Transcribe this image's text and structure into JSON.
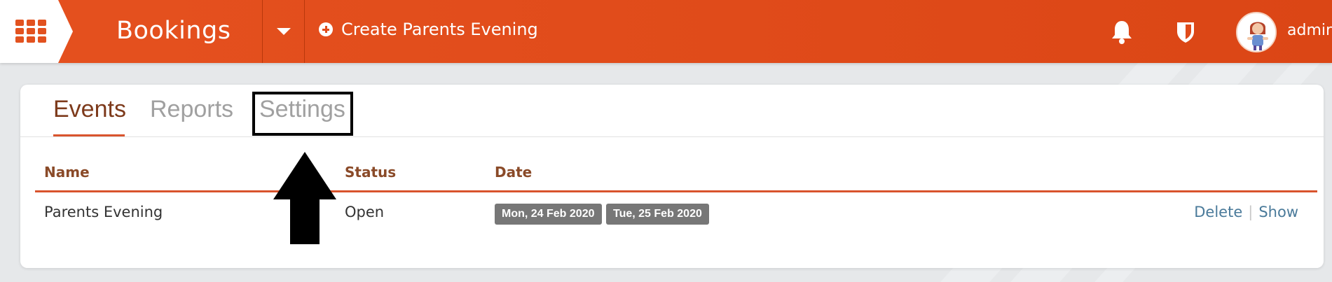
{
  "header": {
    "app_title": "Bookings",
    "create_action_label": "Create Parents Evening",
    "username": "admin",
    "icons": {
      "apps": "apps-grid-icon",
      "dropdown": "chevron-down-icon",
      "create": "plus-circle-icon",
      "notifications": "bell-icon",
      "security": "shield-icon"
    },
    "accent_color": "#e04b1a"
  },
  "tabs": [
    {
      "label": "Events",
      "active": true
    },
    {
      "label": "Reports",
      "active": false
    },
    {
      "label": "Settings",
      "active": false
    }
  ],
  "table": {
    "columns": [
      "Name",
      "Status",
      "Date"
    ],
    "rows": [
      {
        "name": "Parents Evening",
        "status": "Open",
        "dates": [
          "Mon, 24 Feb 2020",
          "Tue, 25 Feb 2020"
        ],
        "actions": [
          "Delete",
          "Show"
        ]
      }
    ]
  },
  "annotation": {
    "highlighted_tab": "Settings",
    "arrow": "up-arrow"
  }
}
